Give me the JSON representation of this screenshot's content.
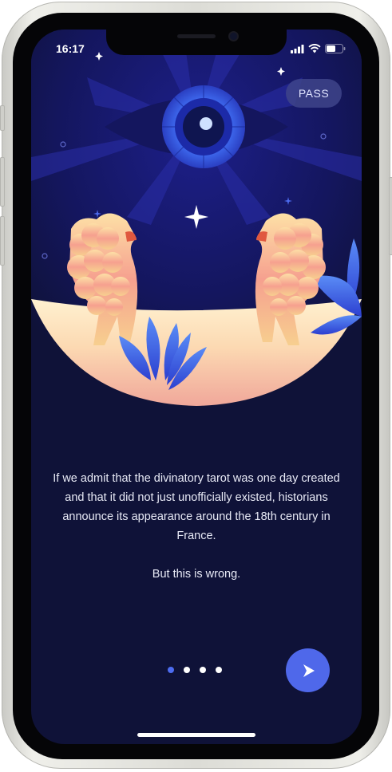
{
  "status": {
    "time": "16:17"
  },
  "onboarding": {
    "pass_label": "PASS",
    "paragraph": "If we admit that the divinatory tarot was one day created and that it did not just unofficially existed, historians announce its appearance around the 18th century in France.",
    "emphasis": "But this is wrong.",
    "pager": {
      "total": 4,
      "active": 1
    }
  },
  "icons": {
    "signal": "cellular-signal-icon",
    "wifi": "wifi-icon",
    "battery": "battery-icon",
    "next": "chevron-right-icon",
    "illustration": "eye-and-lions-icon"
  },
  "colors": {
    "background": "#0f1238",
    "accent": "#4f68ea",
    "pass_button": "#3e448a"
  }
}
